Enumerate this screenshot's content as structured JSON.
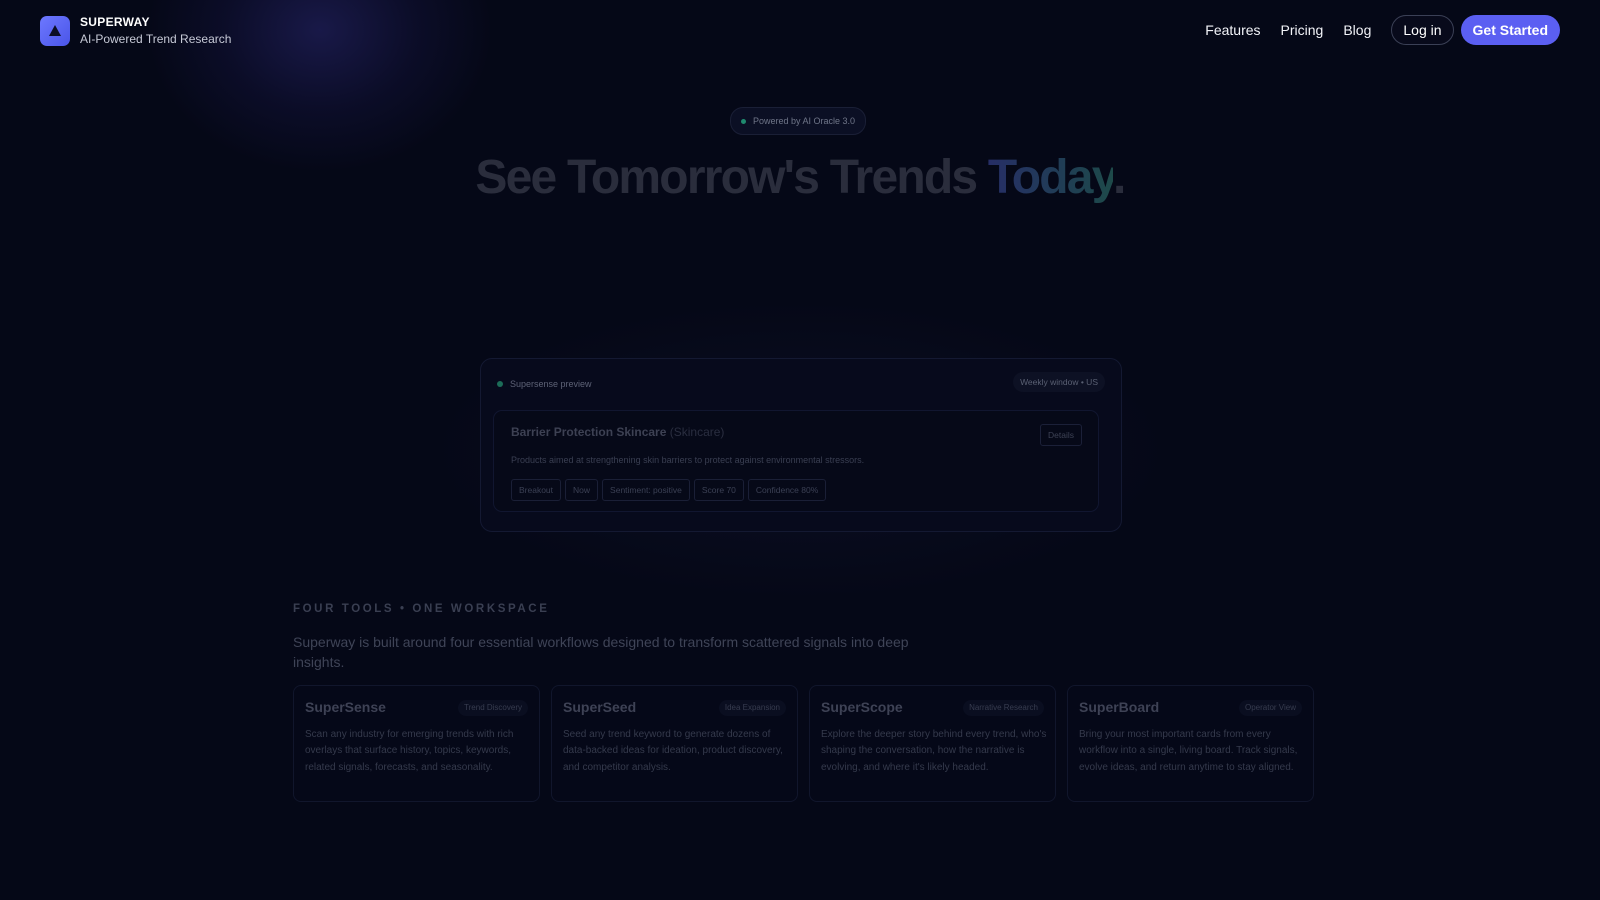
{
  "header": {
    "brand_name": "SUPERWAY",
    "brand_tagline": "AI-Powered Trend Research",
    "nav": [
      "Features",
      "Pricing",
      "Blog"
    ],
    "login_label": "Log in",
    "cta_label": "Get Started"
  },
  "hero": {
    "pill_text": "Powered by AI Oracle 3.0",
    "title_main": "See Tomorrow's Trends ",
    "title_accent": "Today",
    "title_end": "."
  },
  "preview": {
    "label": "Supersense preview",
    "window": "Weekly window • US",
    "card": {
      "title": "Barrier Protection Skincare",
      "category": "(Skincare)",
      "details_label": "Details",
      "description": "Products aimed at strengthening skin barriers to protect against environmental stressors.",
      "tags": [
        "Breakout",
        "Now",
        "Sentiment: positive",
        "Score 70",
        "Confidence 80%"
      ]
    }
  },
  "section": {
    "label": "FOUR TOOLS • ONE WORKSPACE",
    "description": "Superway is built around four essential workflows designed to transform scattered signals into deep insights.",
    "tools": [
      {
        "name": "SuperSense",
        "badge": "Trend Discovery",
        "description": "Scan any industry for emerging trends with rich overlays that surface history, topics, keywords, related signals, forecasts, and seasonality."
      },
      {
        "name": "SuperSeed",
        "badge": "Idea Expansion",
        "description": "Seed any trend keyword to generate dozens of data-backed ideas for ideation, product discovery, and competitor analysis."
      },
      {
        "name": "SuperScope",
        "badge": "Narrative Research",
        "description": "Explore the deeper story behind every trend, who's shaping the conversation, how the narrative is evolving, and where it's likely headed."
      },
      {
        "name": "SuperBoard",
        "badge": "Operator View",
        "description": "Bring your most important cards from every workflow into a single, living board. Track signals, evolve ideas, and return anytime to stay aligned."
      }
    ]
  },
  "colors": {
    "background": "#050817",
    "accent": "#5b5ff2",
    "status_dot": "#1f8a6e"
  }
}
